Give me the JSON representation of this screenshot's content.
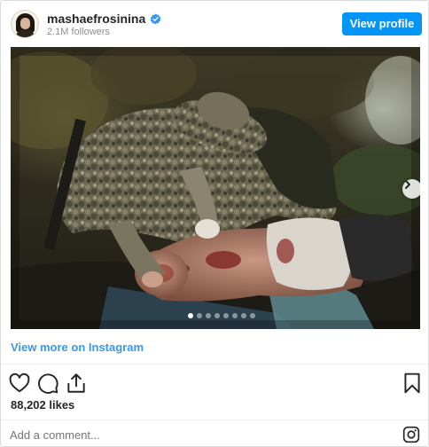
{
  "header": {
    "username": "mashaefrosinina",
    "followers": "2.1M followers",
    "view_profile_label": "View profile",
    "verified_color": "#3897f0",
    "button_color": "#0095f6"
  },
  "media": {
    "current_slide": 1,
    "total_slides": 8
  },
  "footer": {
    "view_more_label": "View more on Instagram",
    "likes": "88,202 likes",
    "comment_placeholder": "Add a comment...",
    "link_color": "#3897f0"
  },
  "icons": {
    "like": "heart-icon",
    "comment": "comment-icon",
    "share": "share-icon",
    "save": "bookmark-icon",
    "next": "chevron-right-icon",
    "brand": "instagram-icon"
  }
}
